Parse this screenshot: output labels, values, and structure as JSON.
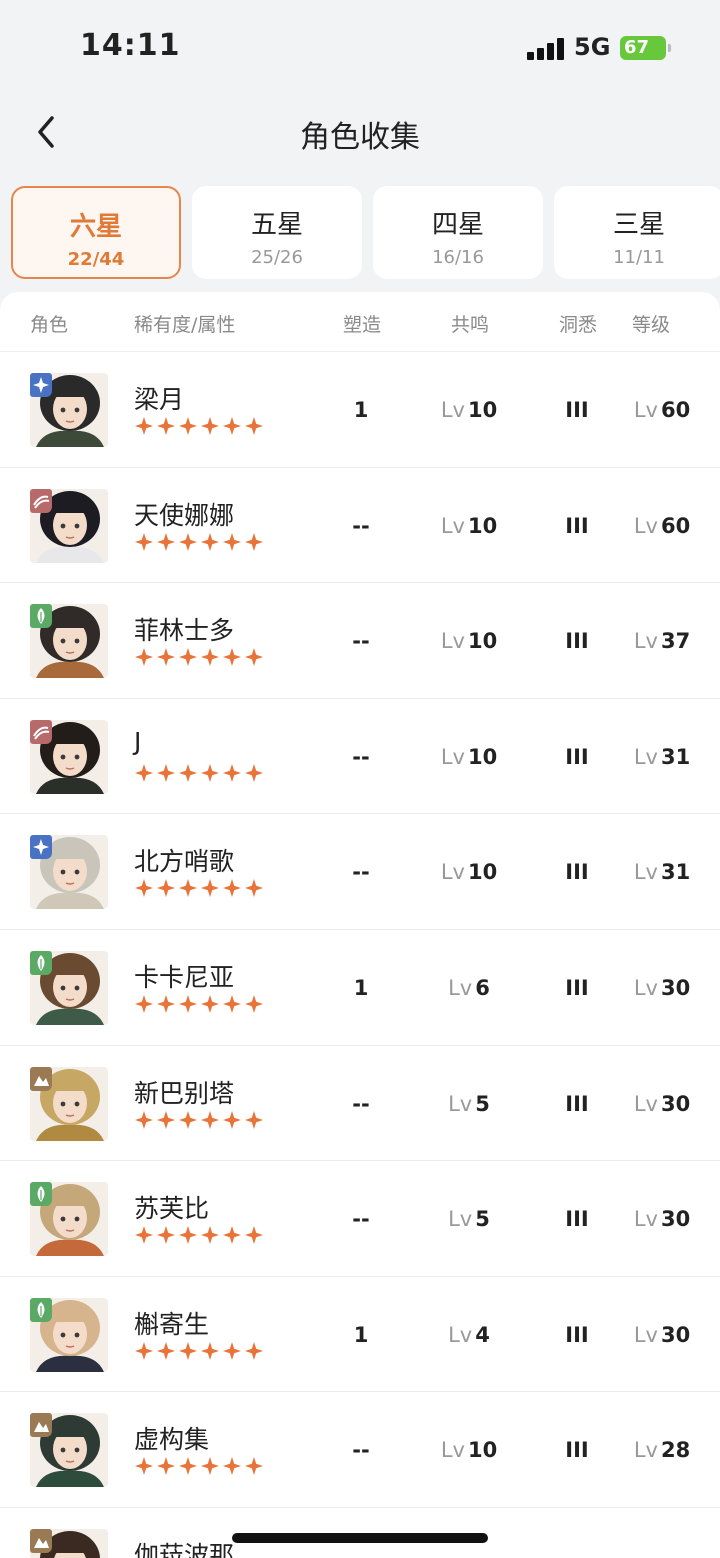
{
  "status_bar": {
    "time": "14:11",
    "network": "5G",
    "battery": "67"
  },
  "nav": {
    "title": "角色收集",
    "back_icon": "chevron-left-icon"
  },
  "tabs": [
    {
      "name": "六星",
      "count": "22/44",
      "active": true
    },
    {
      "name": "五星",
      "count": "25/26",
      "active": false
    },
    {
      "name": "四星",
      "count": "16/16",
      "active": false
    },
    {
      "name": "三星",
      "count": "11/11",
      "active": false
    }
  ],
  "table": {
    "headers": {
      "character": "角色",
      "rarity": "稀有度/属性",
      "portray": "塑造",
      "resonance": "共鸣",
      "insight": "洞悉",
      "level": "等级"
    },
    "lv_prefix": "Lv",
    "star_count": 6,
    "colors": {
      "star": "#e8743a",
      "star_elem": "#4a72c4",
      "beast": "#b86a6a",
      "plant": "#5aaa66",
      "mineral": "#9a7a55"
    },
    "rows": [
      {
        "name": "梁月",
        "element": "star-element-icon",
        "portray": "1",
        "resonance": "10",
        "insight": "III",
        "level": "60"
      },
      {
        "name": "天使娜娜",
        "element": "beast-element-icon",
        "portray": "--",
        "resonance": "10",
        "insight": "III",
        "level": "60"
      },
      {
        "name": "菲林士多",
        "element": "plant-element-icon",
        "portray": "--",
        "resonance": "10",
        "insight": "III",
        "level": "37"
      },
      {
        "name": "J",
        "element": "beast-element-icon",
        "portray": "--",
        "resonance": "10",
        "insight": "III",
        "level": "31"
      },
      {
        "name": "北方哨歌",
        "element": "star-element-icon",
        "portray": "--",
        "resonance": "10",
        "insight": "III",
        "level": "31"
      },
      {
        "name": "卡卡尼亚",
        "element": "plant-element-icon",
        "portray": "1",
        "resonance": "6",
        "insight": "III",
        "level": "30"
      },
      {
        "name": "新巴别塔",
        "element": "mineral-element-icon",
        "portray": "--",
        "resonance": "5",
        "insight": "III",
        "level": "30"
      },
      {
        "name": "苏芙比",
        "element": "plant-element-icon",
        "portray": "--",
        "resonance": "5",
        "insight": "III",
        "level": "30"
      },
      {
        "name": "槲寄生",
        "element": "plant-element-icon",
        "portray": "1",
        "resonance": "4",
        "insight": "III",
        "level": "30"
      },
      {
        "name": "虚构集",
        "element": "mineral-element-icon",
        "portray": "--",
        "resonance": "10",
        "insight": "III",
        "level": "28"
      },
      {
        "name": "伽菈波那",
        "element": "mineral-element-icon",
        "portray": "",
        "resonance": "",
        "insight": "",
        "level": ""
      }
    ]
  }
}
